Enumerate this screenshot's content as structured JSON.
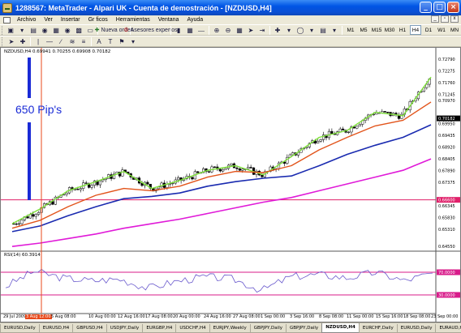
{
  "window": {
    "title": "1288567: MetaTrader - Alpari UK - Cuenta de demostración - [NZDUSD,H4]",
    "buttons": [
      "_",
      "□",
      "×"
    ]
  },
  "menu": [
    "Archivo",
    "Ver",
    "Insertar",
    "Gr ficos",
    "Herramientas",
    "Ventana",
    "Ayuda"
  ],
  "toolbar": {
    "new_order_label": "Nueva orden",
    "expert_advisors_label": "Asesores expertos",
    "timeframes": [
      "M1",
      "M5",
      "M15",
      "M30",
      "H1",
      "H4",
      "D1",
      "W1",
      "MN"
    ],
    "active_timeframe": "H4"
  },
  "chart": {
    "symbol_info": "NZDUSD,H4  0.69941 0.70255 0.69908 0.70182",
    "annotation": "650 Pip's",
    "rsi_info": "RSI(14) 60.3914",
    "price_ticks": [
      "0.72790",
      "0.72275",
      "0.71760",
      "0.71245",
      "0.70970",
      "0.70182",
      "0.69950",
      "0.69435",
      "0.68920",
      "0.68405",
      "0.67890",
      "0.67375",
      "0.66600",
      "0.66345",
      "0.65830",
      "0.65310",
      "0.64550"
    ],
    "current_price": "0.70182",
    "hline_price": "0.66600",
    "rsi_ticks": [
      "70.0000",
      "30.0000"
    ],
    "date_labels": [
      "29 Jul 2009",
      "3 Aug 12:00",
      "5 Aug 08:00",
      "10 Aug 00:00",
      "12 Aug 16:00",
      "17 Aug 08:00",
      "20 Aug 00:00",
      "24 Aug 16:00",
      "27 Aug 08:00",
      "1 Sep 00:00",
      "3 Sep 16:00",
      "8 Sep 08:00",
      "11 Sep 00:00",
      "15 Sep 16:00",
      "18 Sep 08:00",
      "23 Sep 00:00"
    ],
    "highlight_date_index": 1,
    "colors": {
      "candles": "#000000",
      "ma_fast": "#7ee03a",
      "ma_mid": "#e2541b",
      "ma_slow": "#1a2bb0",
      "ma_long": "#e01ad8",
      "hline": "#e0206a",
      "rsi_line": "#6a5acd",
      "rsi_levels": "#d81b8a",
      "vline": "#e8491b",
      "annotation_bar": "#1a2bd6"
    }
  },
  "chart_data": {
    "type": "line",
    "xlabel": "",
    "ylabel": "",
    "x": [
      "29 Jul",
      "3 Aug",
      "5 Aug",
      "10 Aug",
      "12 Aug",
      "17 Aug",
      "20 Aug",
      "24 Aug",
      "27 Aug",
      "1 Sep",
      "3 Sep",
      "8 Sep",
      "11 Sep",
      "15 Sep",
      "18 Sep",
      "23 Sep"
    ],
    "series": [
      {
        "values": [
          0.6555,
          0.662,
          0.67,
          0.674,
          0.6785,
          0.671,
          0.6745,
          0.679,
          0.681,
          0.677,
          0.685,
          0.6935,
          0.6965,
          0.7045,
          0.703,
          0.72
        ]
      },
      {
        "values": [
          0.6535,
          0.657,
          0.663,
          0.668,
          0.671,
          0.67,
          0.672,
          0.676,
          0.6785,
          0.678,
          0.681,
          0.688,
          0.6935,
          0.6985,
          0.701,
          0.709
        ]
      },
      {
        "values": [
          0.652,
          0.6545,
          0.659,
          0.663,
          0.6665,
          0.6675,
          0.669,
          0.672,
          0.674,
          0.6755,
          0.6765,
          0.681,
          0.686,
          0.69,
          0.6935,
          0.699
        ]
      },
      {
        "values": [
          0.6455,
          0.647,
          0.649,
          0.651,
          0.6535,
          0.6555,
          0.6575,
          0.66,
          0.6625,
          0.665,
          0.667,
          0.67,
          0.673,
          0.676,
          0.679,
          0.684
        ]
      }
    ],
    "ylim": [
      0.6445,
      0.73
    ],
    "rsi": {
      "values": [
        45,
        72,
        60,
        55,
        58,
        42,
        54,
        62,
        58,
        38,
        62,
        66,
        60,
        70,
        55,
        68
      ],
      "ylim": [
        0,
        100
      ],
      "levels": [
        70,
        30
      ]
    }
  },
  "tabs": {
    "items": [
      "EURUSD,Daily",
      "EURUSD,H4",
      "GBPUSD,H4",
      "USDJPY,Daily",
      "EURGBP,H4",
      "USDCHF,H4",
      "EURJPY,Weekly",
      "GBPJPY,Daily",
      "GBPJPY,Daily",
      "NZDUSD,H4",
      "EURCHF,Daily",
      "EURUSD,Daily",
      "EURAUD,H"
    ],
    "active_index": 9,
    "nav": [
      "◄",
      "►"
    ]
  }
}
